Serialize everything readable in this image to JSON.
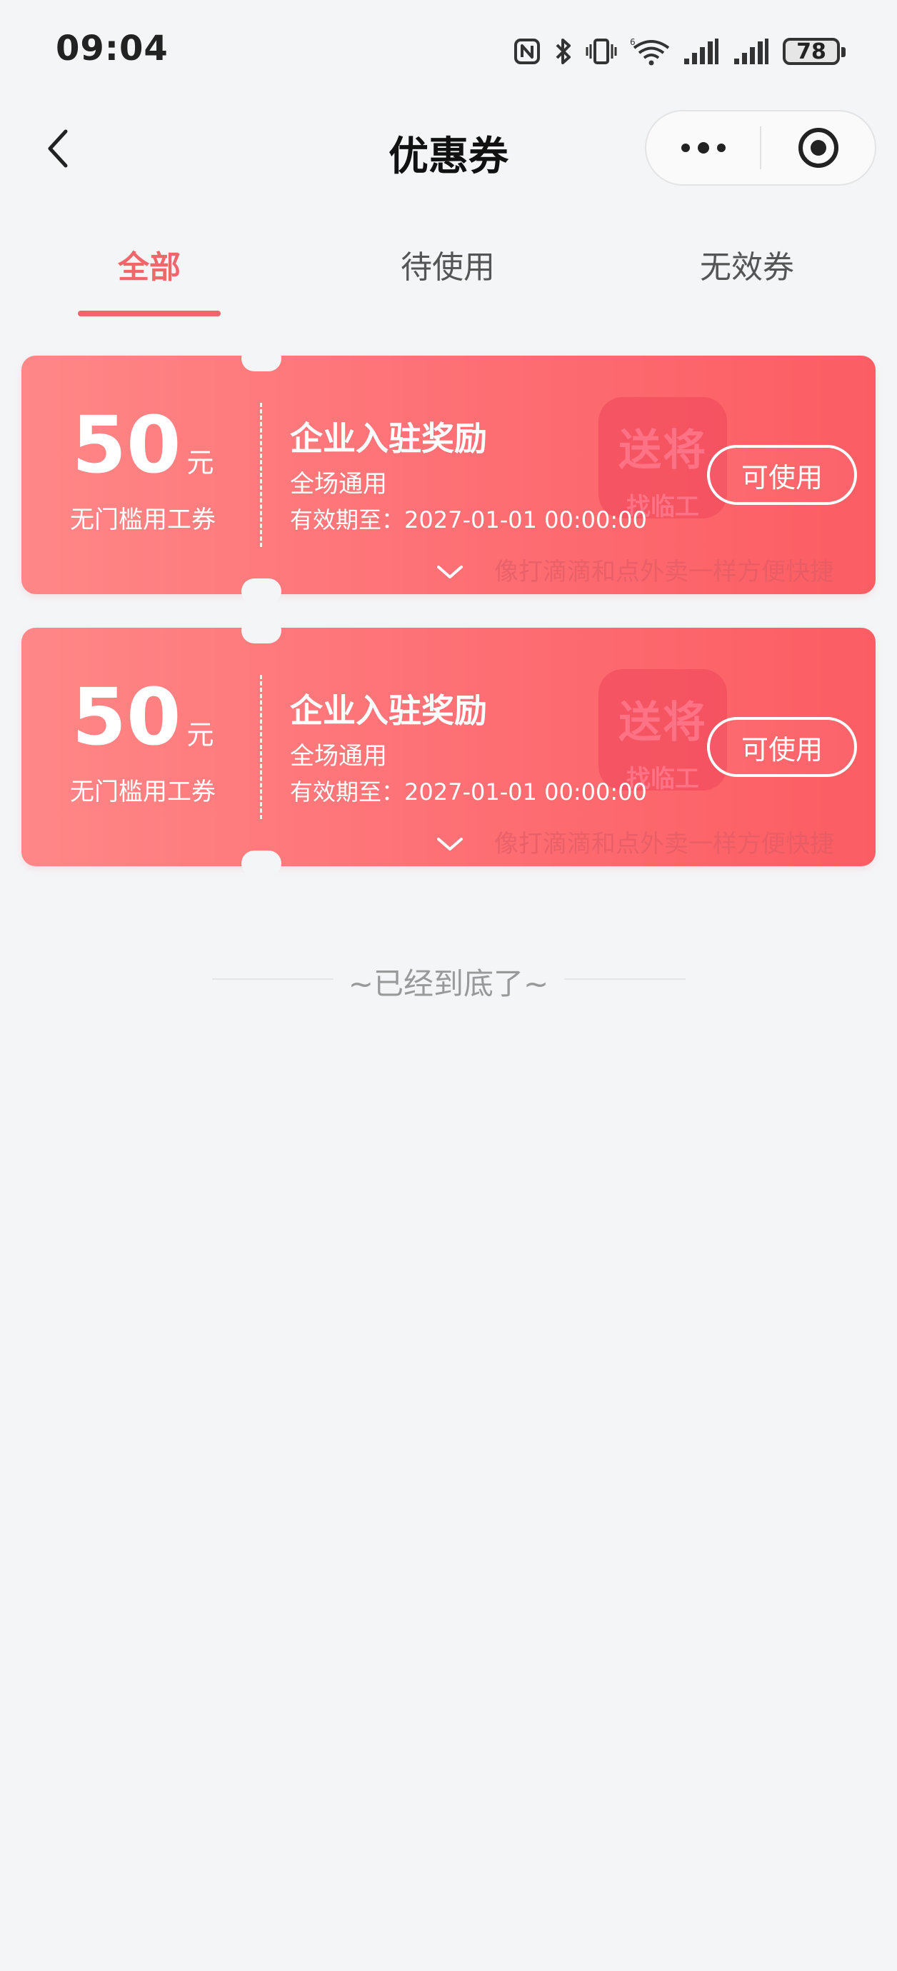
{
  "status_bar": {
    "time": "09:04",
    "battery": "78"
  },
  "nav": {
    "title": "优惠券"
  },
  "tabs": [
    {
      "label": "全部",
      "active": true
    },
    {
      "label": "待使用",
      "active": false
    },
    {
      "label": "无效券",
      "active": false
    }
  ],
  "theme": {
    "accent": "#f0676b",
    "coupon_gradient_start": "#ff8787",
    "coupon_gradient_end": "#fb5d63",
    "background": "#f4f5f7"
  },
  "coupons": [
    {
      "amount": "50",
      "unit": "元",
      "type": "无门槛用工券",
      "title": "企业入驻奖励",
      "scope": "全场通用",
      "expiry": "有效期至：2027-01-01 00:00:00",
      "button": "可使用",
      "watermark_logo_top": "送将",
      "watermark_logo_bottom": "找临工",
      "watermark_slogan": "像打滴滴和点外卖一样方便快捷"
    },
    {
      "amount": "50",
      "unit": "元",
      "type": "无门槛用工券",
      "title": "企业入驻奖励",
      "scope": "全场通用",
      "expiry": "有效期至：2027-01-01 00:00:00",
      "button": "可使用",
      "watermark_logo_top": "送将",
      "watermark_logo_bottom": "找临工",
      "watermark_slogan": "像打滴滴和点外卖一样方便快捷"
    }
  ],
  "list_end": {
    "text": "~已经到底了~"
  }
}
